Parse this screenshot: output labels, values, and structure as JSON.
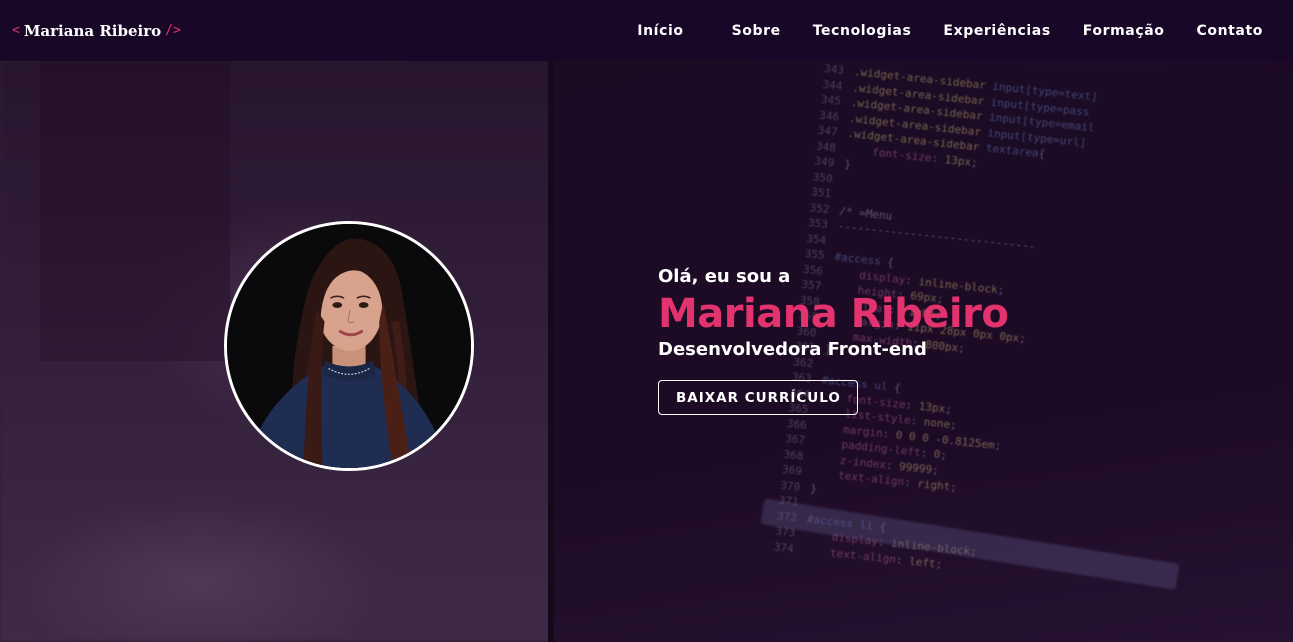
{
  "logo": {
    "open_bracket": "<",
    "name": "Mariana Ribeiro",
    "close_bracket": "/>"
  },
  "nav": {
    "items": [
      {
        "label": "Início"
      },
      {
        "label": "Sobre"
      },
      {
        "label": "Tecnologias"
      },
      {
        "label": "Experiências"
      },
      {
        "label": "Formação"
      },
      {
        "label": "Contato"
      }
    ]
  },
  "hero": {
    "greeting": "Olá, eu sou a",
    "name": "Mariana Ribeiro",
    "role": "Desenvolvedora Front-end",
    "cv_button_label": "BAIXAR CURRÍCULO"
  },
  "colors": {
    "accent": "#e2336f",
    "navbar": "#180726",
    "text": "#ffffff"
  },
  "icons": [
    "profile-photo"
  ]
}
